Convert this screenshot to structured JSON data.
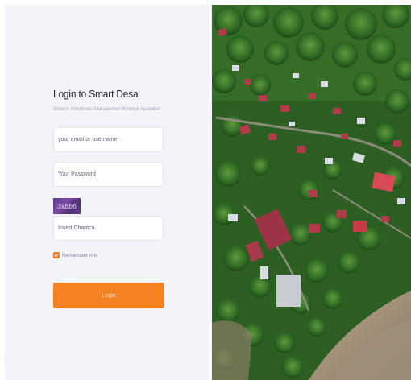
{
  "login": {
    "title": "Login to Smart Desa",
    "subtitle": "Sistem Informasi Manajemen Kinerja Aparatur",
    "email_placeholder": "your email or username",
    "password_placeholder": "Your Password",
    "captcha_text": "3xbb6",
    "captcha_placeholder": "Insert Chaptca",
    "remember_label": "Remember me",
    "login_label": "Login"
  },
  "colors": {
    "accent": "#f58220",
    "panel_bg": "#f3f4f9"
  },
  "icons": {
    "checkbox": "check-icon"
  }
}
